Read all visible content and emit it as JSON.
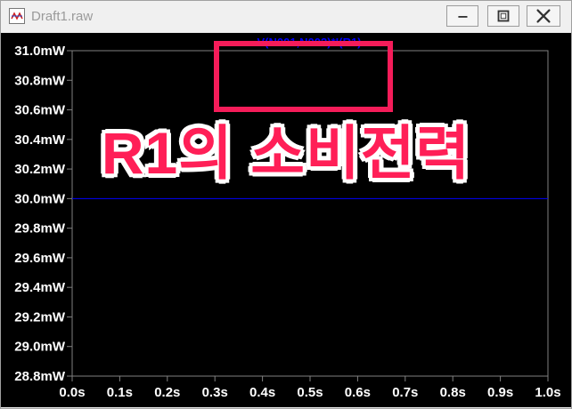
{
  "window": {
    "title": "Draft1.raw",
    "buttons": {
      "minimize": "minimize-icon",
      "maximize": "maximize-icon",
      "close": "close-icon"
    }
  },
  "plot": {
    "trace_label": "V(N001,N002)*I(R1)",
    "overlay_text": "R1의 소비전력",
    "colors": {
      "background": "#000000",
      "trace": "#0000ff",
      "axis_text": "#ffffff",
      "grid": "#808080",
      "highlight": "#f51c59"
    }
  },
  "chart_data": {
    "type": "line",
    "title": "",
    "xlabel": "",
    "ylabel": "",
    "xlim": [
      0,
      1
    ],
    "ylim": [
      28.8,
      31.0
    ],
    "x_ticks": [
      "0.0s",
      "0.1s",
      "0.2s",
      "0.3s",
      "0.4s",
      "0.5s",
      "0.6s",
      "0.7s",
      "0.8s",
      "0.9s",
      "1.0s"
    ],
    "y_ticks": [
      "31.0mW",
      "30.8mW",
      "30.6mW",
      "30.4mW",
      "30.2mW",
      "30.0mW",
      "29.8mW",
      "29.6mW",
      "29.4mW",
      "29.2mW",
      "29.0mW",
      "28.8mW"
    ],
    "series": [
      {
        "name": "V(N001,N002)*I(R1)",
        "x": [
          0,
          1
        ],
        "y": [
          30.0,
          30.0
        ]
      }
    ],
    "grid": false
  }
}
